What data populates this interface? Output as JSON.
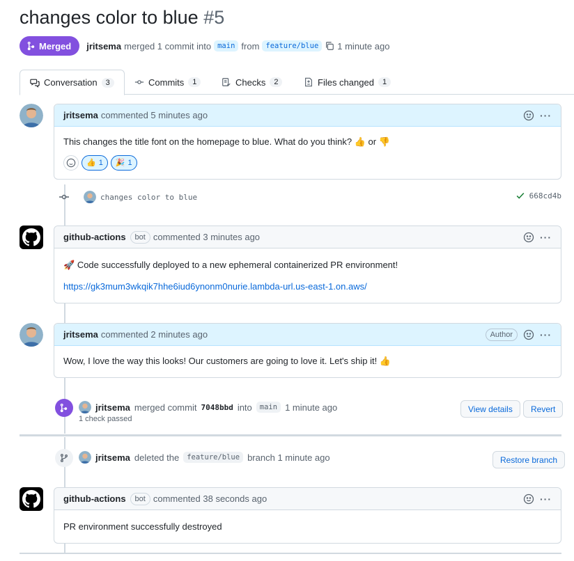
{
  "pr": {
    "title": "changes color to blue",
    "number": "#5",
    "state_label": "Merged",
    "author": "jritsema",
    "merge_text": "merged 1 commit into",
    "base_branch": "main",
    "from_text": "from",
    "head_branch": "feature/blue",
    "time": "1 minute ago"
  },
  "tabs": [
    {
      "label": "Conversation",
      "count": "3"
    },
    {
      "label": "Commits",
      "count": "1"
    },
    {
      "label": "Checks",
      "count": "2"
    },
    {
      "label": "Files changed",
      "count": "1"
    }
  ],
  "comments": [
    {
      "author": "jritsema",
      "meta": "commented 5 minutes ago",
      "body_text": "This changes the title font on the homepage to blue. What do you think?",
      "body_or": "or",
      "reactions": [
        {
          "emoji": "👍",
          "count": "1"
        },
        {
          "emoji": "🎉",
          "count": "1"
        }
      ]
    },
    {
      "author": "github-actions",
      "bot": "bot",
      "meta": "commented 3 minutes ago",
      "body_text": "Code successfully deployed to a new ephemeral containerized PR environment!",
      "link": "https://gk3mum3wkqik7hhe6iud6ynonm0nurie.lambda-url.us-east-1.on.aws/"
    },
    {
      "author": "jritsema",
      "meta": "commented 2 minutes ago",
      "author_badge": "Author",
      "body_text": "Wow, I love the way this looks! Our customers are going to love it. Let's ship it!"
    },
    {
      "author": "github-actions",
      "bot": "bot",
      "meta": "commented 38 seconds ago",
      "body_text": "PR environment successfully destroyed"
    }
  ],
  "commit_event": {
    "message": "changes color to blue",
    "sha": "668cd4b"
  },
  "merge_event": {
    "author": "jritsema",
    "text": "merged commit",
    "sha": "7048bbd",
    "into": "into",
    "branch": "main",
    "time": "1 minute ago",
    "checks": "1 check passed",
    "view_details": "View details",
    "revert": "Revert"
  },
  "delete_event": {
    "author": "jritsema",
    "text": "deleted the",
    "branch": "feature/blue",
    "suffix": "branch 1 minute ago",
    "restore": "Restore branch"
  },
  "colors": {
    "merged": "#8250df",
    "link": "#0969da",
    "highlight_header": "#ddf4ff",
    "success": "#1a7f37"
  }
}
